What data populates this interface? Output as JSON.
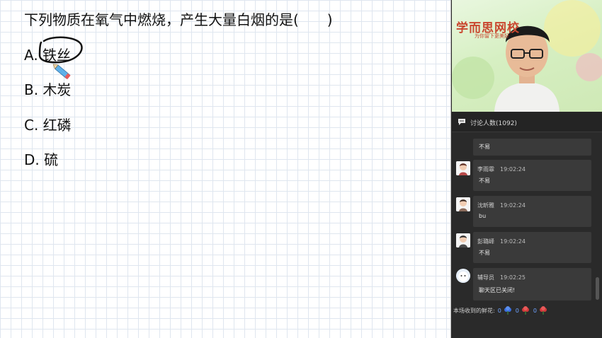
{
  "question": {
    "text": "下列物质在氧气中燃烧，产生大量白烟的是(　　)",
    "options": [
      {
        "text": "A. 铁丝"
      },
      {
        "text": "B. 木炭"
      },
      {
        "text": "C. 红磷"
      },
      {
        "text": "D. 硫"
      }
    ]
  },
  "video": {
    "logo_text": "学而思网校",
    "logo_sub": "为你留下更美好"
  },
  "chat": {
    "title": "讨论人数(1092)",
    "messages": [
      {
        "name": "",
        "time": "",
        "text": "不易"
      },
      {
        "name": "李雨霏",
        "time": "19:02:24",
        "text": "不易"
      },
      {
        "name": "沈昕雅",
        "time": "19:02:24",
        "text": "bu"
      },
      {
        "name": "彭璐峄",
        "time": "19:02:24",
        "text": "不易"
      },
      {
        "name": "辅导员",
        "time": "19:02:25",
        "text": "聊天区已关闭!"
      }
    ],
    "flowers": {
      "label": "本场收到的鲜花:",
      "counts": [
        "0",
        "0",
        "0"
      ],
      "colors": [
        "#3b6fe0",
        "#d23a3a",
        "#d23a3a"
      ]
    }
  },
  "colors": {
    "panel_bg": "#2a2a2a",
    "message_bg": "#3a3a3a",
    "annotation": "#111111",
    "pen": "#5fb0e8"
  }
}
